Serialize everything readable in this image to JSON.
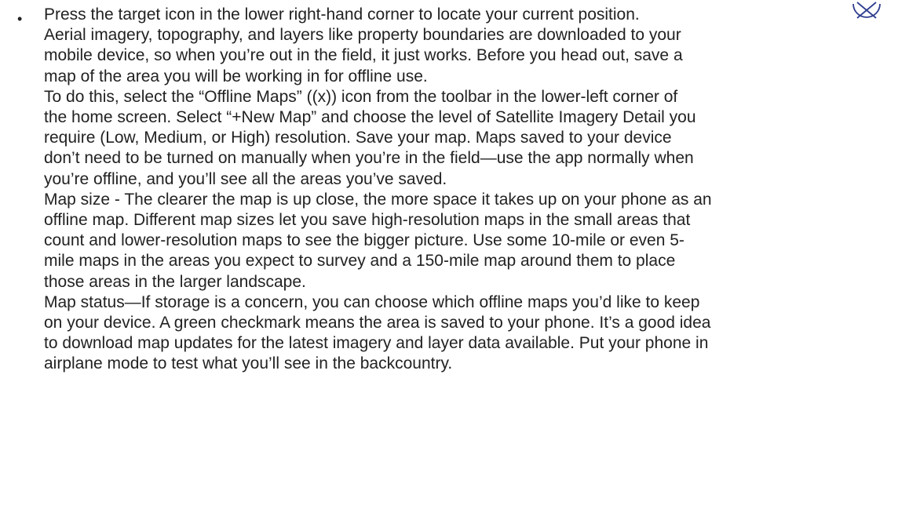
{
  "document": {
    "bullet": "•",
    "lines": [
      "Press the target icon in the lower right-hand corner to locate your current position.",
      "Aerial imagery, topography, and layers like property boundaries are downloaded to your",
      "mobile device, so when you’re out in the field, it just works. Before you head out, save a",
      "map of the area you will be working in for offline use.",
      "To do this, select the “Offline Maps” ((x)) icon from the toolbar in the lower-left corner of",
      "the home screen. Select “+New Map” and choose the level of Satellite Imagery Detail you",
      "require (Low, Medium, or High) resolution. Save your map. Maps saved to your device",
      "don’t need to be turned on manually when you’re in the field—use the app normally when",
      "you’re offline, and you’ll see all the areas you’ve saved.",
      "Map size - The clearer the map is up close, the more space it takes up on your phone as an",
      "offline map. Different map sizes let you save high-resolution maps in the small areas that",
      "count and lower-resolution maps to see the bigger picture. Use some 10-mile or even 5-",
      "mile maps in the areas you expect to survey and a 150-mile map around them to place",
      "those areas in the larger landscape.",
      "Map status—If storage is a concern, you can choose which offline maps you’d like to keep",
      "on your device. A green checkmark means the area is saved to your phone. It’s a good idea",
      "to download map updates for the latest imagery and layer data available. Put your phone in",
      "airplane mode to test what you’ll see in the backcountry."
    ],
    "icon_name": "target-icon",
    "icon_color": "#2f3e8f"
  }
}
